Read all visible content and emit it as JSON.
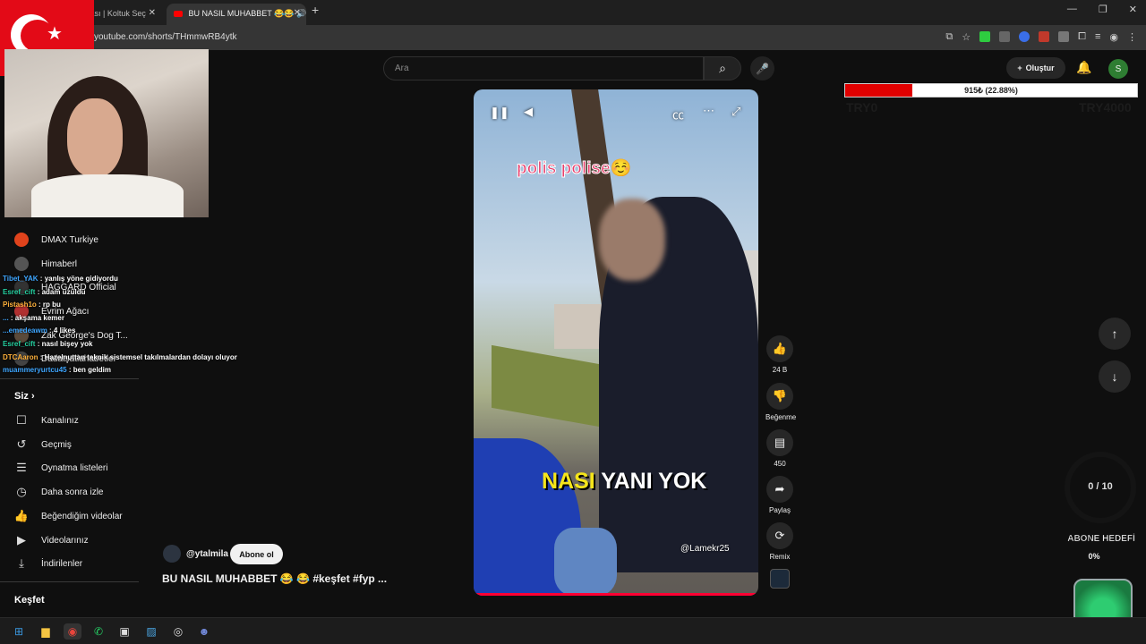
{
  "browser": {
    "tabs": [
      {
        "title": "itası | Koltuk Seç",
        "active": false
      },
      {
        "title": "BU NASIL MUHABBET 😂😂 🔊",
        "active": true
      }
    ],
    "url": "youtube.com/shorts/THmmwRB4ytk",
    "window_buttons": [
      "—",
      "❐",
      "✕"
    ]
  },
  "header": {
    "search_placeholder": "Ara",
    "create_label": "Oluştur",
    "avatar_letter": "S"
  },
  "donation_goal": {
    "text": "915₺ (22.88%)",
    "percent": 22.88,
    "min_label": "TRY0",
    "max_label": "TRY4000"
  },
  "sidebar": {
    "subscriptions": [
      {
        "name": "DMAX Turkiye"
      },
      {
        "name": "Himaberl"
      },
      {
        "name": "HAGGARD Official"
      },
      {
        "name": "Evrim Ağacı"
      },
      {
        "name": "Zak George's Dog T..."
      },
      {
        "name": "Dadatşatlahabetler"
      }
    ],
    "you_section_title": "Siz",
    "you_items": [
      {
        "label": "Kanalınız",
        "icon": "channel-icon"
      },
      {
        "label": "Geçmiş",
        "icon": "history-icon"
      },
      {
        "label": "Oynatma listeleri",
        "icon": "playlist-icon"
      },
      {
        "label": "Daha sonra izle",
        "icon": "clock-icon"
      },
      {
        "label": "Beğendiğim videolar",
        "icon": "like-icon"
      },
      {
        "label": "Videolarınız",
        "icon": "video-icon"
      },
      {
        "label": "İndirilenler",
        "icon": "download-icon"
      }
    ],
    "explore_title": "Keşfet"
  },
  "chat": [
    {
      "user": "Tibet_YAK",
      "message": "yanlış yöne gidiyordu"
    },
    {
      "user": "Esref_cift",
      "message": "adam üzüldü"
    },
    {
      "user": "Pistash1o",
      "message": "rp bu"
    },
    {
      "user": "...",
      "message": "akşama kemer"
    },
    {
      "user": "...emedeawm",
      "message": "4 likes"
    },
    {
      "user": "Esref_cift",
      "message": "nasıl bişey yok"
    },
    {
      "user": "DTCAaron",
      "message": "Hazelnuttan teknik sistemsel takılmalardan dolayı oluyor"
    },
    {
      "user": "muammeryurtcu45",
      "message": "ben geldim"
    }
  ],
  "video": {
    "caption_top": "polis polise☺️",
    "caption_bottom_highlight": "NASI",
    "caption_bottom_rest": " YANI YOK",
    "watermark": "@Lamekr25",
    "channel": "@ytalmila",
    "subscribe_label": "Abone ol",
    "title": "BU NASIL MUHABBET 😂 😂 #keşfet #fyp ..."
  },
  "actions": [
    {
      "name": "like",
      "icon": "thumbs-up-icon",
      "label": "24 B"
    },
    {
      "name": "dislike",
      "icon": "thumbs-down-icon",
      "label": "Beğenme"
    },
    {
      "name": "comments",
      "icon": "comment-icon",
      "label": "450"
    },
    {
      "name": "share",
      "icon": "share-icon",
      "label": "Paylaş"
    },
    {
      "name": "remix",
      "icon": "remix-icon",
      "label": "Remix"
    }
  ],
  "overlay": {
    "sub_counter": "0 / 10",
    "sub_goal_title": "ABONE HEDEFİ",
    "sub_goal_percent": "0%"
  }
}
